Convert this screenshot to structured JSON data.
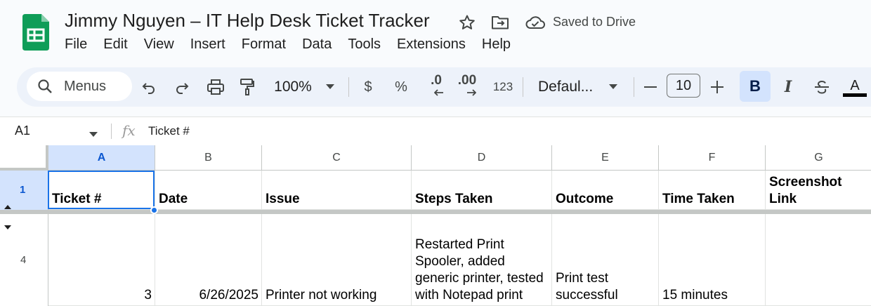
{
  "document": {
    "title": "Jimmy Nguyen – IT Help Desk Ticket Tracker",
    "save_status": "Saved to Drive"
  },
  "menu": [
    "File",
    "Edit",
    "View",
    "Insert",
    "Format",
    "Data",
    "Tools",
    "Extensions",
    "Help"
  ],
  "toolbar": {
    "search_label": "Menus",
    "zoom": "100%",
    "currency": "$",
    "percent": "%",
    "decrease_decimal": ".0",
    "increase_decimal": ".00",
    "more_formats": "123",
    "font": "Defaul...",
    "font_size": "10",
    "bold": "B",
    "italic": "I",
    "text_color": "A"
  },
  "formula_bar": {
    "cell_ref": "A1",
    "fx": "fx",
    "value": "Ticket #"
  },
  "columns": [
    "A",
    "B",
    "C",
    "D",
    "E",
    "F",
    "G"
  ],
  "rows": [
    {
      "number": "1",
      "cells": [
        "Ticket #",
        "Date",
        "Issue",
        "Steps Taken",
        "Outcome",
        "Time Taken",
        "Screenshot Link"
      ]
    },
    {
      "number": "4",
      "cells": [
        "3",
        "6/26/2025",
        "Printer not working",
        "Restarted Print Spooler, added generic printer, tested with Notepad print",
        "Print test successful",
        "15 minutes",
        ""
      ]
    }
  ],
  "colors": {
    "accent": "#1a73e8",
    "selected_header": "#d3e3fd",
    "sheets_green": "#0f9d58"
  }
}
